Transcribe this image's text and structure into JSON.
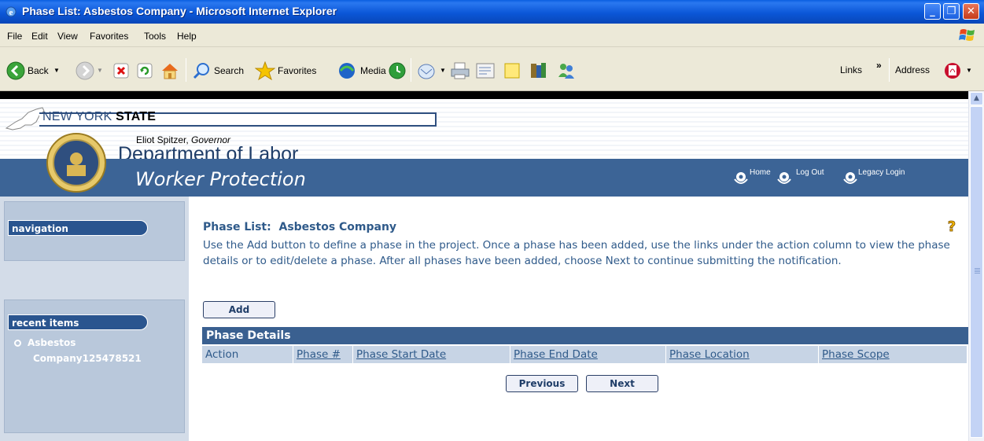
{
  "window": {
    "title": "Phase List: Asbestos Company - Microsoft Internet Explorer",
    "minimize": "_",
    "maximize": "❐",
    "close": "✕"
  },
  "menu": [
    "File",
    "Edit",
    "View",
    "Favorites",
    "Tools",
    "Help"
  ],
  "toolbar": {
    "back": "Back",
    "search": "Search",
    "favorites": "Favorites",
    "media": "Media",
    "links": "Links",
    "chevron": "»",
    "address": "Address"
  },
  "header": {
    "state_prefix": "NEW YORK ",
    "state_bold": "STATE",
    "governor_name": "Eliot Spitzer, ",
    "governor_title": "Governor",
    "department": "Department of Labor",
    "division": "Worker Protection",
    "links": {
      "home": "Home",
      "logout": "Log Out",
      "legacy": "Legacy Login"
    }
  },
  "sidebar": {
    "navigation_label": "navigation",
    "recent_label": "recent items",
    "recent_items": [
      "Asbestos",
      "Company125478521"
    ]
  },
  "main": {
    "title_label": "Phase List:",
    "title_value": "Asbestos Company",
    "instructions": "Use the Add button to define a phase in the project. Once a phase has been added, use the links under the action column to view the phase details or to edit/delete a phase. After all phases have been added, choose Next to continue submitting the notification.",
    "add_button": "Add",
    "section_header": "Phase Details",
    "columns": [
      "Action",
      "Phase #",
      "Phase Start Date",
      "Phase End Date",
      "Phase Location",
      "Phase Scope"
    ],
    "previous_button": "Previous",
    "next_button": "Next"
  },
  "colors": {
    "title_bar": "#0b57d8",
    "chrome": "#ece9d8",
    "banner_blue": "#3c6496",
    "sidebar_bg": "#d3dce8",
    "nav_pill": "#2a558f",
    "text_blue": "#2f5a8a",
    "section_header": "#3a6090",
    "table_header_bg": "#c7d4e5"
  },
  "icons": [
    "ie-icon",
    "windows-logo-icon",
    "back-arrow-icon",
    "forward-arrow-icon",
    "stop-icon",
    "refresh-icon",
    "home-icon",
    "search-icon",
    "favorites-star-icon",
    "media-icon",
    "history-icon",
    "mail-icon",
    "print-icon",
    "edit-icon",
    "discuss-icon",
    "research-icon",
    "messenger-icon",
    "pdf-icon",
    "ny-state-outline-icon",
    "ny-seal-icon",
    "help-icon"
  ]
}
